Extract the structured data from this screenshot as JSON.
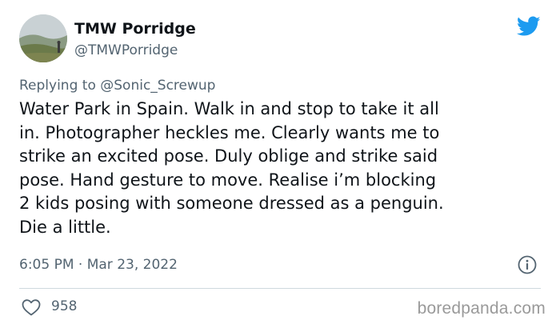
{
  "author": {
    "name": "TMW Porridge",
    "handle": "@TMWPorridge"
  },
  "reply": {
    "prefix": "Replying to ",
    "mention": "@Sonic_Screwup"
  },
  "tweet": {
    "text": "Water Park in Spain. Walk in and stop to take it all\nin. Photographer heckles me. Clearly wants me to\nstrike an excited pose. Duly oblige and strike said\npose. Hand gesture to move. Realise i’m blocking\n2 kids posing with someone dressed as a penguin.\nDie a little.",
    "timestamp": "6:05 PM · Mar 23, 2022"
  },
  "stats": {
    "likes": "958"
  },
  "watermark": "boredpanda.com",
  "colors": {
    "brand_blue": "#1d9bf0",
    "secondary_text": "#536471",
    "primary_text": "#0f1419"
  },
  "icons": {
    "brand": "twitter-bird-icon",
    "info": "info-icon",
    "like": "heart-outline-icon"
  }
}
